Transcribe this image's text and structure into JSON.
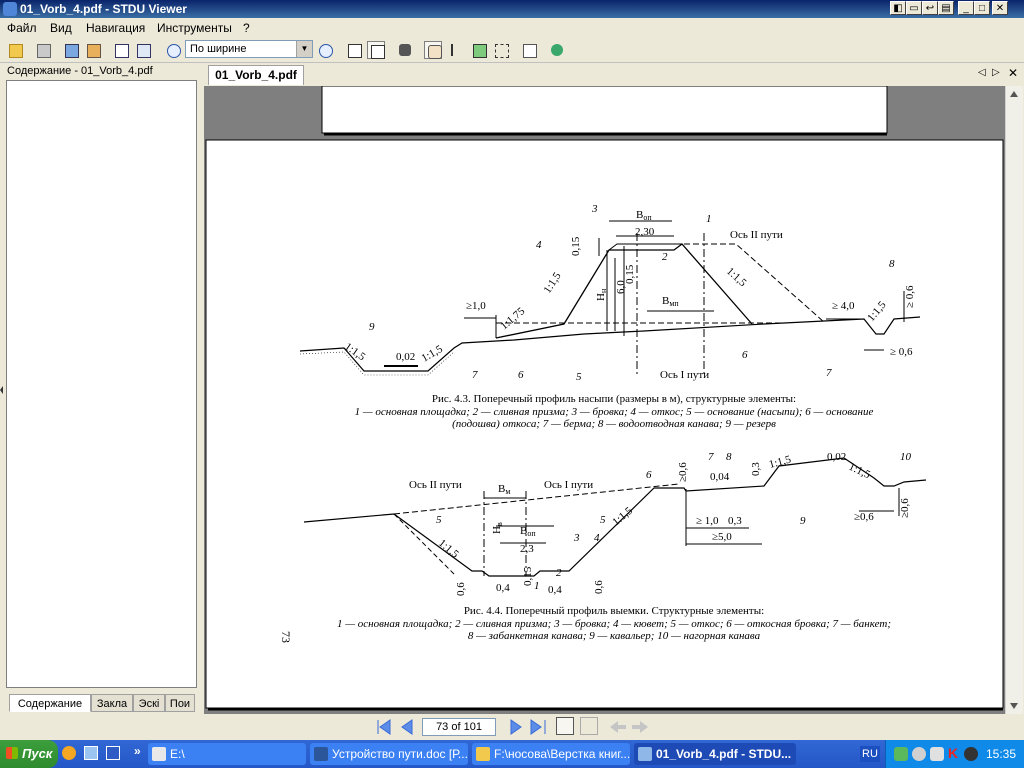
{
  "window": {
    "title": "01_Vorb_4.pdf - STDU Viewer"
  },
  "menu": [
    "Файл",
    "Вид",
    "Навигация",
    "Инструменты",
    "?"
  ],
  "toolbar": {
    "zoom_value": "По ширине"
  },
  "left_panel": {
    "header": "Содержание - 01_Vorb_4.pdf",
    "tabs": [
      "Содержание",
      "Закла",
      "Эскі",
      "Пои"
    ]
  },
  "doc_tab": "01_Vorb_4.pdf",
  "navigation": {
    "page_indicator": "73 of 101"
  },
  "page": {
    "page_number": "73",
    "fig1": {
      "caption_title": "Рис. 4.3. Поперечный профиль насыпи (размеры в м), структурные элементы:",
      "caption_line2": "1 — основная площадка; 2 — сливная призма; 3 — бровка; 4 — откос; 5 — основание (насыпи); 6 — основание",
      "caption_line3": "(подошва) откоса; 7 — берма; 8 — водоотводная канава; 9 — резерв",
      "labels": {
        "b_op": "B",
        "b_op_sub": "оп",
        "w230": "2,30",
        "axis2": "Ось II пути",
        "axis1": "Ось I пути",
        "h015a": "0,15",
        "h015b": "0,15",
        "h60": "6,0",
        "hn": "H",
        "hn_sub": "н",
        "bmp": "B",
        "bmp_sub": "мп",
        "s1": "1:1,5",
        "s2": "1:1,5",
        "s3": "1:1,75",
        "s4": "1:1,5",
        "s5": "1:1,5",
        "s6": "1:1,5",
        "ge10": "≥1,0",
        "ge40": "≥ 4,0",
        "ge06a": "≥ 0,6",
        "ge06b": "≥ 0,6",
        "slope002": "0,02",
        "n1": "1",
        "n2": "2",
        "n3": "3",
        "n4": "4",
        "n5": "5",
        "n6a": "6",
        "n6b": "6",
        "n7a": "7",
        "n7b": "7",
        "n8": "8",
        "n9": "9"
      }
    },
    "fig2": {
      "caption_title": "Рис. 4.4. Поперечный профиль выемки. Структурные элементы:",
      "caption_line2": "1 — основная площадка; 2 — сливная призма; 3 — бровка; 4 — кювет; 5 — откос; 6 — откосная бровка; 7 — банкет;",
      "caption_line3": "8 — забанкетная канава; 9 — кавальер; 10 — нагорная канава",
      "labels": {
        "axis2": "Ось II пути",
        "axis1": "Ось I пути",
        "bm": "B",
        "bm_sub": "м",
        "hv": "H",
        "hv_sub": "в",
        "bop": "B",
        "bop_sub": "оп",
        "w23": "2,3",
        "s1": "1:1,5",
        "s2": "1:1,5",
        "s3": "1:1,5",
        "s4": "1:1,5",
        "d06a": "0,6",
        "d04a": "0,4",
        "d015": "0,15",
        "d04b": "0,4",
        "d06b": "0,6",
        "ge06top": "≥0,6",
        "d004": "0,04",
        "d03a": "0,3",
        "d002": "0,02",
        "ge10": "≥ 1,0",
        "d03b": "0,3",
        "ge50": "≥5,0",
        "ge06r": "≥0,6",
        "ge06v": "≥0,6",
        "n1": "1",
        "n2": "2",
        "n3": "3",
        "n4": "4",
        "n5a": "5",
        "n5b": "5",
        "n6": "6",
        "n7": "7",
        "n8": "8",
        "n9": "9",
        "n10": "10"
      }
    }
  },
  "taskbar": {
    "start_label": "Пуск",
    "tasks": [
      "E:\\",
      "Устройство пути.doc [Р...",
      "F:\\носова\\Верстка книг...",
      "01_Vorb_4.pdf - STDU..."
    ],
    "language": "RU",
    "clock": "15:35"
  }
}
